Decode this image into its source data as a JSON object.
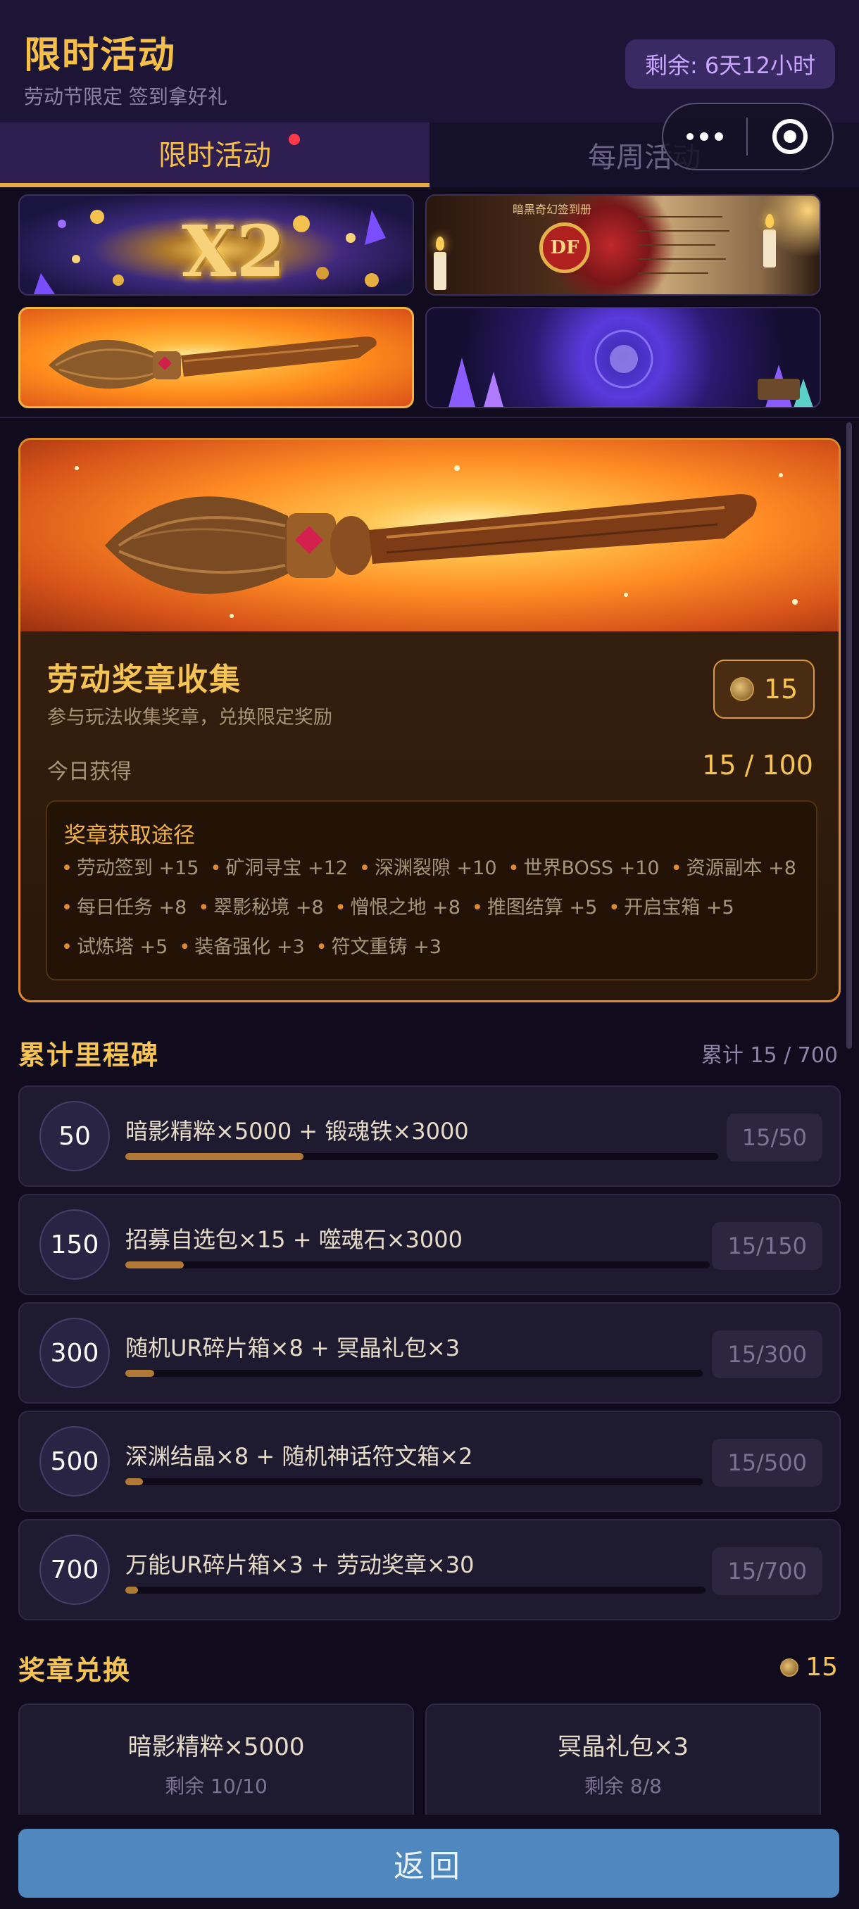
{
  "header": {
    "title": "限时活动",
    "subtitle": "劳动节限定 签到拿好礼",
    "countdown": "剩余: 6天12小时"
  },
  "tabs": [
    {
      "label": "限时活动",
      "active": true,
      "has_dot": true
    },
    {
      "label": "每周活动",
      "active": false,
      "has_dot": false
    }
  ],
  "banners": {
    "double": {
      "text": "X2"
    },
    "book": {
      "title": "暗黑奇幻签到册",
      "logo": "DF"
    }
  },
  "medal_card": {
    "title": "劳动奖章收集",
    "description": "参与玩法收集奖章，兑换限定奖励",
    "medal_count": "15",
    "today_label": "今日获得",
    "today_value": "15 / 100",
    "ways_title": "奖章获取途径",
    "ways": [
      "劳动签到 +15",
      "矿洞寻宝 +12",
      "深渊裂隙 +10",
      "世界BOSS +10",
      "资源副本 +8",
      "每日任务 +8",
      "翠影秘境 +8",
      "憎恨之地 +8",
      "推图结算 +5",
      "开启宝箱 +5",
      "试炼塔 +5",
      "装备强化 +3",
      "符文重铸 +3"
    ]
  },
  "milestones": {
    "title": "累计里程碑",
    "total": "累计 15 / 700",
    "items": [
      {
        "threshold": "50",
        "reward": "暗影精粹×5000 + 锻魂铁×3000",
        "progress_text": "15/50",
        "progress": 0.3
      },
      {
        "threshold": "150",
        "reward": "招募自选包×15 + 噬魂石×3000",
        "progress_text": "15/150",
        "progress": 0.1
      },
      {
        "threshold": "300",
        "reward": "随机UR碎片箱×8 + 冥晶礼包×3",
        "progress_text": "15/300",
        "progress": 0.05
      },
      {
        "threshold": "500",
        "reward": "深渊结晶×8 + 随机神话符文箱×2",
        "progress_text": "15/500",
        "progress": 0.03
      },
      {
        "threshold": "700",
        "reward": "万能UR碎片箱×3 + 劳动奖章×30",
        "progress_text": "15/700",
        "progress": 0.02
      }
    ]
  },
  "exchange": {
    "title": "奖章兑换",
    "medal_count": "15",
    "items": [
      {
        "name": "暗影精粹×5000",
        "remaining": "剩余 10/10"
      },
      {
        "name": "冥晶礼包×3",
        "remaining": "剩余 8/8"
      }
    ]
  },
  "footer": {
    "back_label": "返回"
  },
  "colors": {
    "accent_gold": "#f6c453",
    "card_border": "#e08a2e",
    "back_button": "#4f87bf",
    "tab_dot": "#ff3b4a"
  }
}
